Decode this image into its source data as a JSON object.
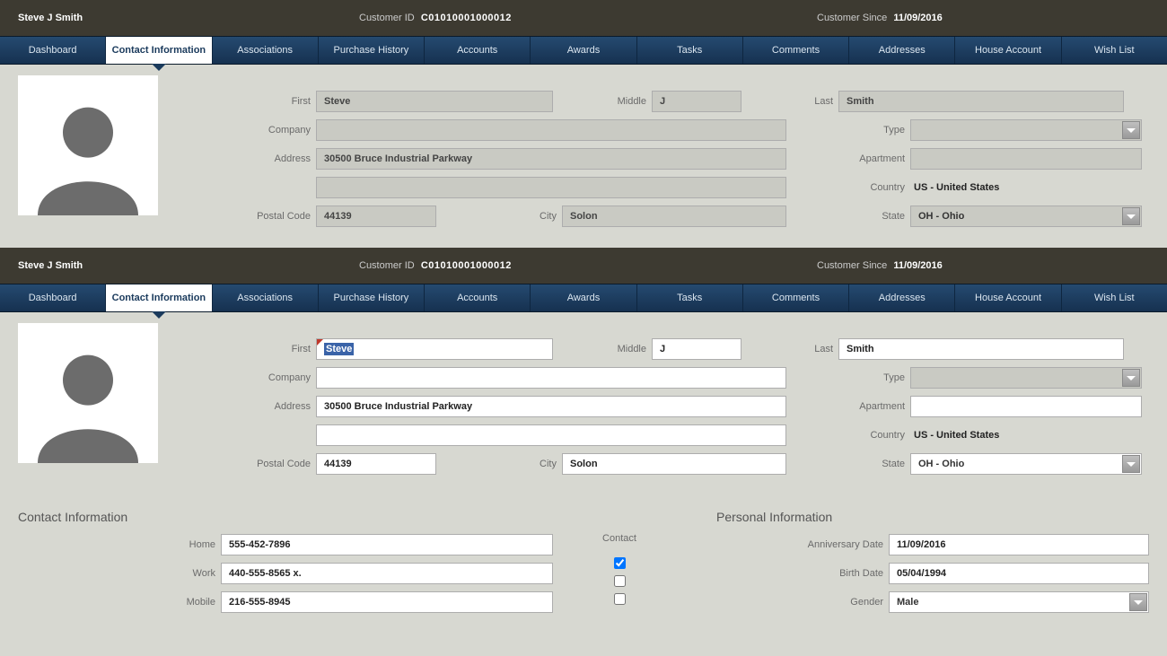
{
  "header": {
    "customer_name": "Steve J Smith",
    "customer_id_label": "Customer ID",
    "customer_id": "C01010001000012",
    "since_label": "Customer Since",
    "since": "11/09/2016"
  },
  "tabs": [
    "Dashboard",
    "Contact Information",
    "Associations",
    "Purchase History",
    "Accounts",
    "Awards",
    "Tasks",
    "Comments",
    "Addresses",
    "House Account",
    "Wish List"
  ],
  "active_tab": "Contact Information",
  "labels": {
    "first": "First",
    "middle": "Middle",
    "last": "Last",
    "company": "Company",
    "type": "Type",
    "address": "Address",
    "apartment": "Apartment",
    "country": "Country",
    "postal": "Postal Code",
    "city": "City",
    "state": "State",
    "contact_info": "Contact Information",
    "personal_info": "Personal Information",
    "contact": "Contact",
    "home": "Home",
    "work": "Work",
    "mobile": "Mobile",
    "anniversary": "Anniversary Date",
    "birth": "Birth Date",
    "gender": "Gender"
  },
  "values": {
    "first": "Steve",
    "middle": "J",
    "last": "Smith",
    "company": "",
    "type": "",
    "address1": "30500 Bruce Industrial Parkway",
    "address2": "",
    "apartment": "",
    "country": "US - United States",
    "postal": "44139",
    "city": "Solon",
    "state": "OH - Ohio",
    "home": "555-452-7896",
    "work": "440-555-8565 x.",
    "mobile": "216-555-8945",
    "contact_home": true,
    "contact_work": false,
    "contact_mobile": false,
    "anniversary": "11/09/2016",
    "birth": "05/04/1994",
    "gender": "Male"
  }
}
